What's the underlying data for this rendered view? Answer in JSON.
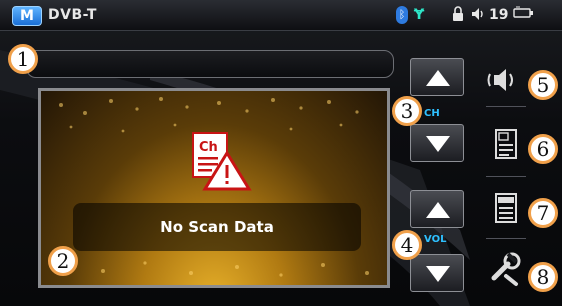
{
  "statusbar": {
    "logo_letter": "M",
    "app_title": "DVB-T",
    "bluetooth_glyph": "ᛒ",
    "antenna_glyph": "Ɏ",
    "lock_glyph": "🔒",
    "volume_glyph": "🔈",
    "volume_level": "19",
    "battery_glyph": "▭"
  },
  "screen": {
    "message": "No Scan Data",
    "icon_label": "Ch"
  },
  "controls": {
    "ch_label": "CH",
    "vol_label": "VOL"
  },
  "callouts": {
    "c1": "1",
    "c2": "2",
    "c3": "3",
    "c4": "4",
    "c5": "5",
    "c6": "6",
    "c7": "7",
    "c8": "8"
  },
  "colors": {
    "accent": "#2ec0ff",
    "callout_border": "#f0a04a",
    "video_gold": "#e8b12a",
    "warning_red": "#d21a1a"
  },
  "icons": [
    "bluetooth-icon",
    "antenna-icon",
    "lock-icon",
    "volume-icon",
    "battery-icon",
    "channel-list-icon",
    "speaker-icon",
    "epg-icon",
    "teletext-icon",
    "settings-wrench-icon",
    "arrow-up-icon",
    "arrow-down-icon"
  ]
}
